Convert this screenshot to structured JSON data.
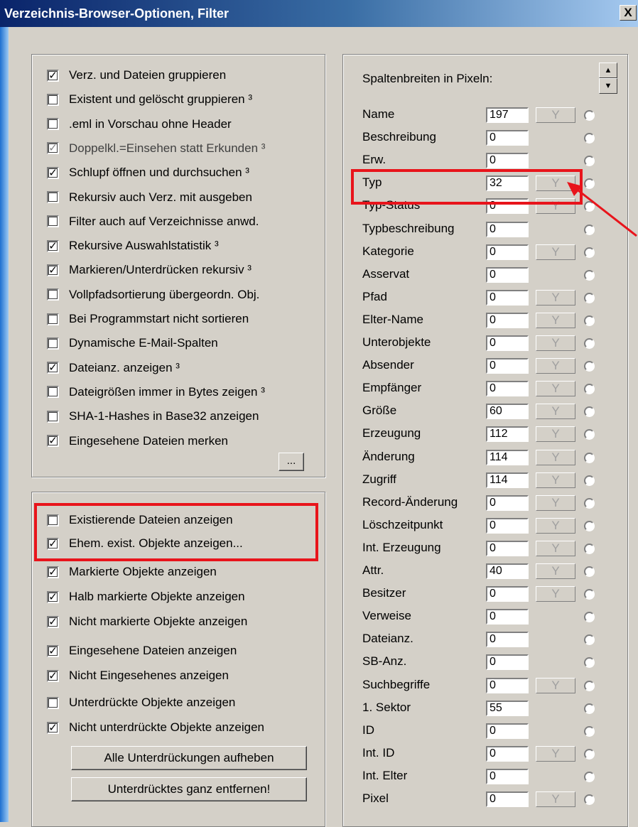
{
  "window": {
    "title": "Verzeichnis-Browser-Optionen, Filter",
    "close_label": "X"
  },
  "options_group": [
    {
      "label": "Verz. und Dateien gruppieren",
      "checked": true,
      "ul_first": true
    },
    {
      "label": "Existent und gelöscht gruppieren ³",
      "checked": false,
      "ul_first": true
    },
    {
      "label": ".eml in Vorschau ohne Header",
      "checked": false
    },
    {
      "label": "Doppelkl.=Einsehen statt Erkunden ³",
      "checked": true,
      "disabled": true
    },
    {
      "label": "Schlupf öffnen und durchsuchen ³",
      "checked": true,
      "ul_first": true
    },
    {
      "label": "Rekursiv auch Verz. mit ausgeben",
      "checked": false,
      "ul_first": true
    },
    {
      "label": "Filter auch auf Verzeichnisse anwd.",
      "checked": false
    },
    {
      "label": "Rekursive Auswahlstatistik ³",
      "checked": true
    },
    {
      "label": "Markieren/Unterdrücken rekursiv ³",
      "checked": true
    },
    {
      "label": "Vollpfadsortierung übergeordn. Obj.",
      "checked": false
    },
    {
      "label": "Bei Programmstart nicht sortieren",
      "checked": false
    },
    {
      "label": "Dynamische E-Mail-Spalten",
      "checked": false
    },
    {
      "label": "Dateianz. anzeigen ³",
      "checked": true
    },
    {
      "label": "Dateigrößen immer in Bytes zeigen ³",
      "checked": false
    },
    {
      "label": "SHA-1-Hashes in Base32 anzeigen",
      "checked": false
    },
    {
      "label": "Eingesehene Dateien merken",
      "checked": true
    }
  ],
  "ellipsis_button": "...",
  "display_group": [
    {
      "label": "Existierende Dateien anzeigen",
      "checked": false
    },
    {
      "label": "Ehem. exist. Objekte anzeigen...",
      "checked": true
    },
    {
      "label": "Markierte Objekte anzeigen",
      "checked": true
    },
    {
      "label": "Halb markierte Objekte anzeigen",
      "checked": true
    },
    {
      "label": "Nicht markierte Objekte anzeigen",
      "checked": true
    },
    {
      "label": "Eingesehene Dateien anzeigen",
      "checked": true
    },
    {
      "label": "Nicht Eingesehenes anzeigen",
      "checked": true
    },
    {
      "label": "Unterdrückte Objekte anzeigen",
      "checked": false
    },
    {
      "label": "Nicht unterdrückte Objekte anzeigen",
      "checked": true
    }
  ],
  "buttons": {
    "clear_suppress": "Alle Unterdrückungen aufheben",
    "remove_suppressed": "Unterdrücktes ganz entfernen!"
  },
  "columns_header": "Spaltenbreiten in Pixeln:",
  "filter_glyph": "Y",
  "columns": [
    {
      "name": "Name",
      "width": "197",
      "filter": true
    },
    {
      "name": "Beschreibung",
      "width": "0",
      "filter": false
    },
    {
      "name": "Erw.",
      "width": "0",
      "filter": false
    },
    {
      "name": "Typ",
      "width": "32",
      "filter": true
    },
    {
      "name": "Typ-Status",
      "width": "0",
      "filter": true
    },
    {
      "name": "Typbeschreibung",
      "width": "0",
      "filter": false
    },
    {
      "name": "Kategorie",
      "width": "0",
      "filter": true
    },
    {
      "name": "Asservat",
      "width": "0",
      "filter": false
    },
    {
      "name": "Pfad",
      "width": "0",
      "filter": true
    },
    {
      "name": "Elter-Name",
      "width": "0",
      "filter": true
    },
    {
      "name": "Unterobjekte",
      "width": "0",
      "filter": true
    },
    {
      "name": "Absender",
      "width": "0",
      "filter": true
    },
    {
      "name": "Empfänger",
      "width": "0",
      "filter": true
    },
    {
      "name": "Größe",
      "width": "60",
      "filter": true
    },
    {
      "name": "Erzeugung",
      "width": "112",
      "filter": true
    },
    {
      "name": "Änderung",
      "width": "114",
      "filter": true
    },
    {
      "name": "Zugriff",
      "width": "114",
      "filter": true
    },
    {
      "name": "Record-Änderung",
      "width": "0",
      "filter": true
    },
    {
      "name": "Löschzeitpunkt",
      "width": "0",
      "filter": true
    },
    {
      "name": "Int. Erzeugung",
      "width": "0",
      "filter": true
    },
    {
      "name": "Attr.",
      "width": "40",
      "filter": true
    },
    {
      "name": "Besitzer",
      "width": "0",
      "filter": true
    },
    {
      "name": "Verweise",
      "width": "0",
      "filter": false
    },
    {
      "name": "Dateianz.",
      "width": "0",
      "filter": false
    },
    {
      "name": "SB-Anz.",
      "width": "0",
      "filter": false
    },
    {
      "name": "Suchbegriffe",
      "width": "0",
      "filter": true
    },
    {
      "name": "1. Sektor",
      "width": "55",
      "filter": false
    },
    {
      "name": "ID",
      "width": "0",
      "filter": false
    },
    {
      "name": "Int. ID",
      "width": "0",
      "filter": true
    },
    {
      "name": "Int. Elter",
      "width": "0",
      "filter": false
    },
    {
      "name": "Pixel",
      "width": "0",
      "filter": true
    }
  ],
  "colors": {
    "annotation_red": "#e8141b",
    "dialog_bg": "#d4d0c8"
  }
}
